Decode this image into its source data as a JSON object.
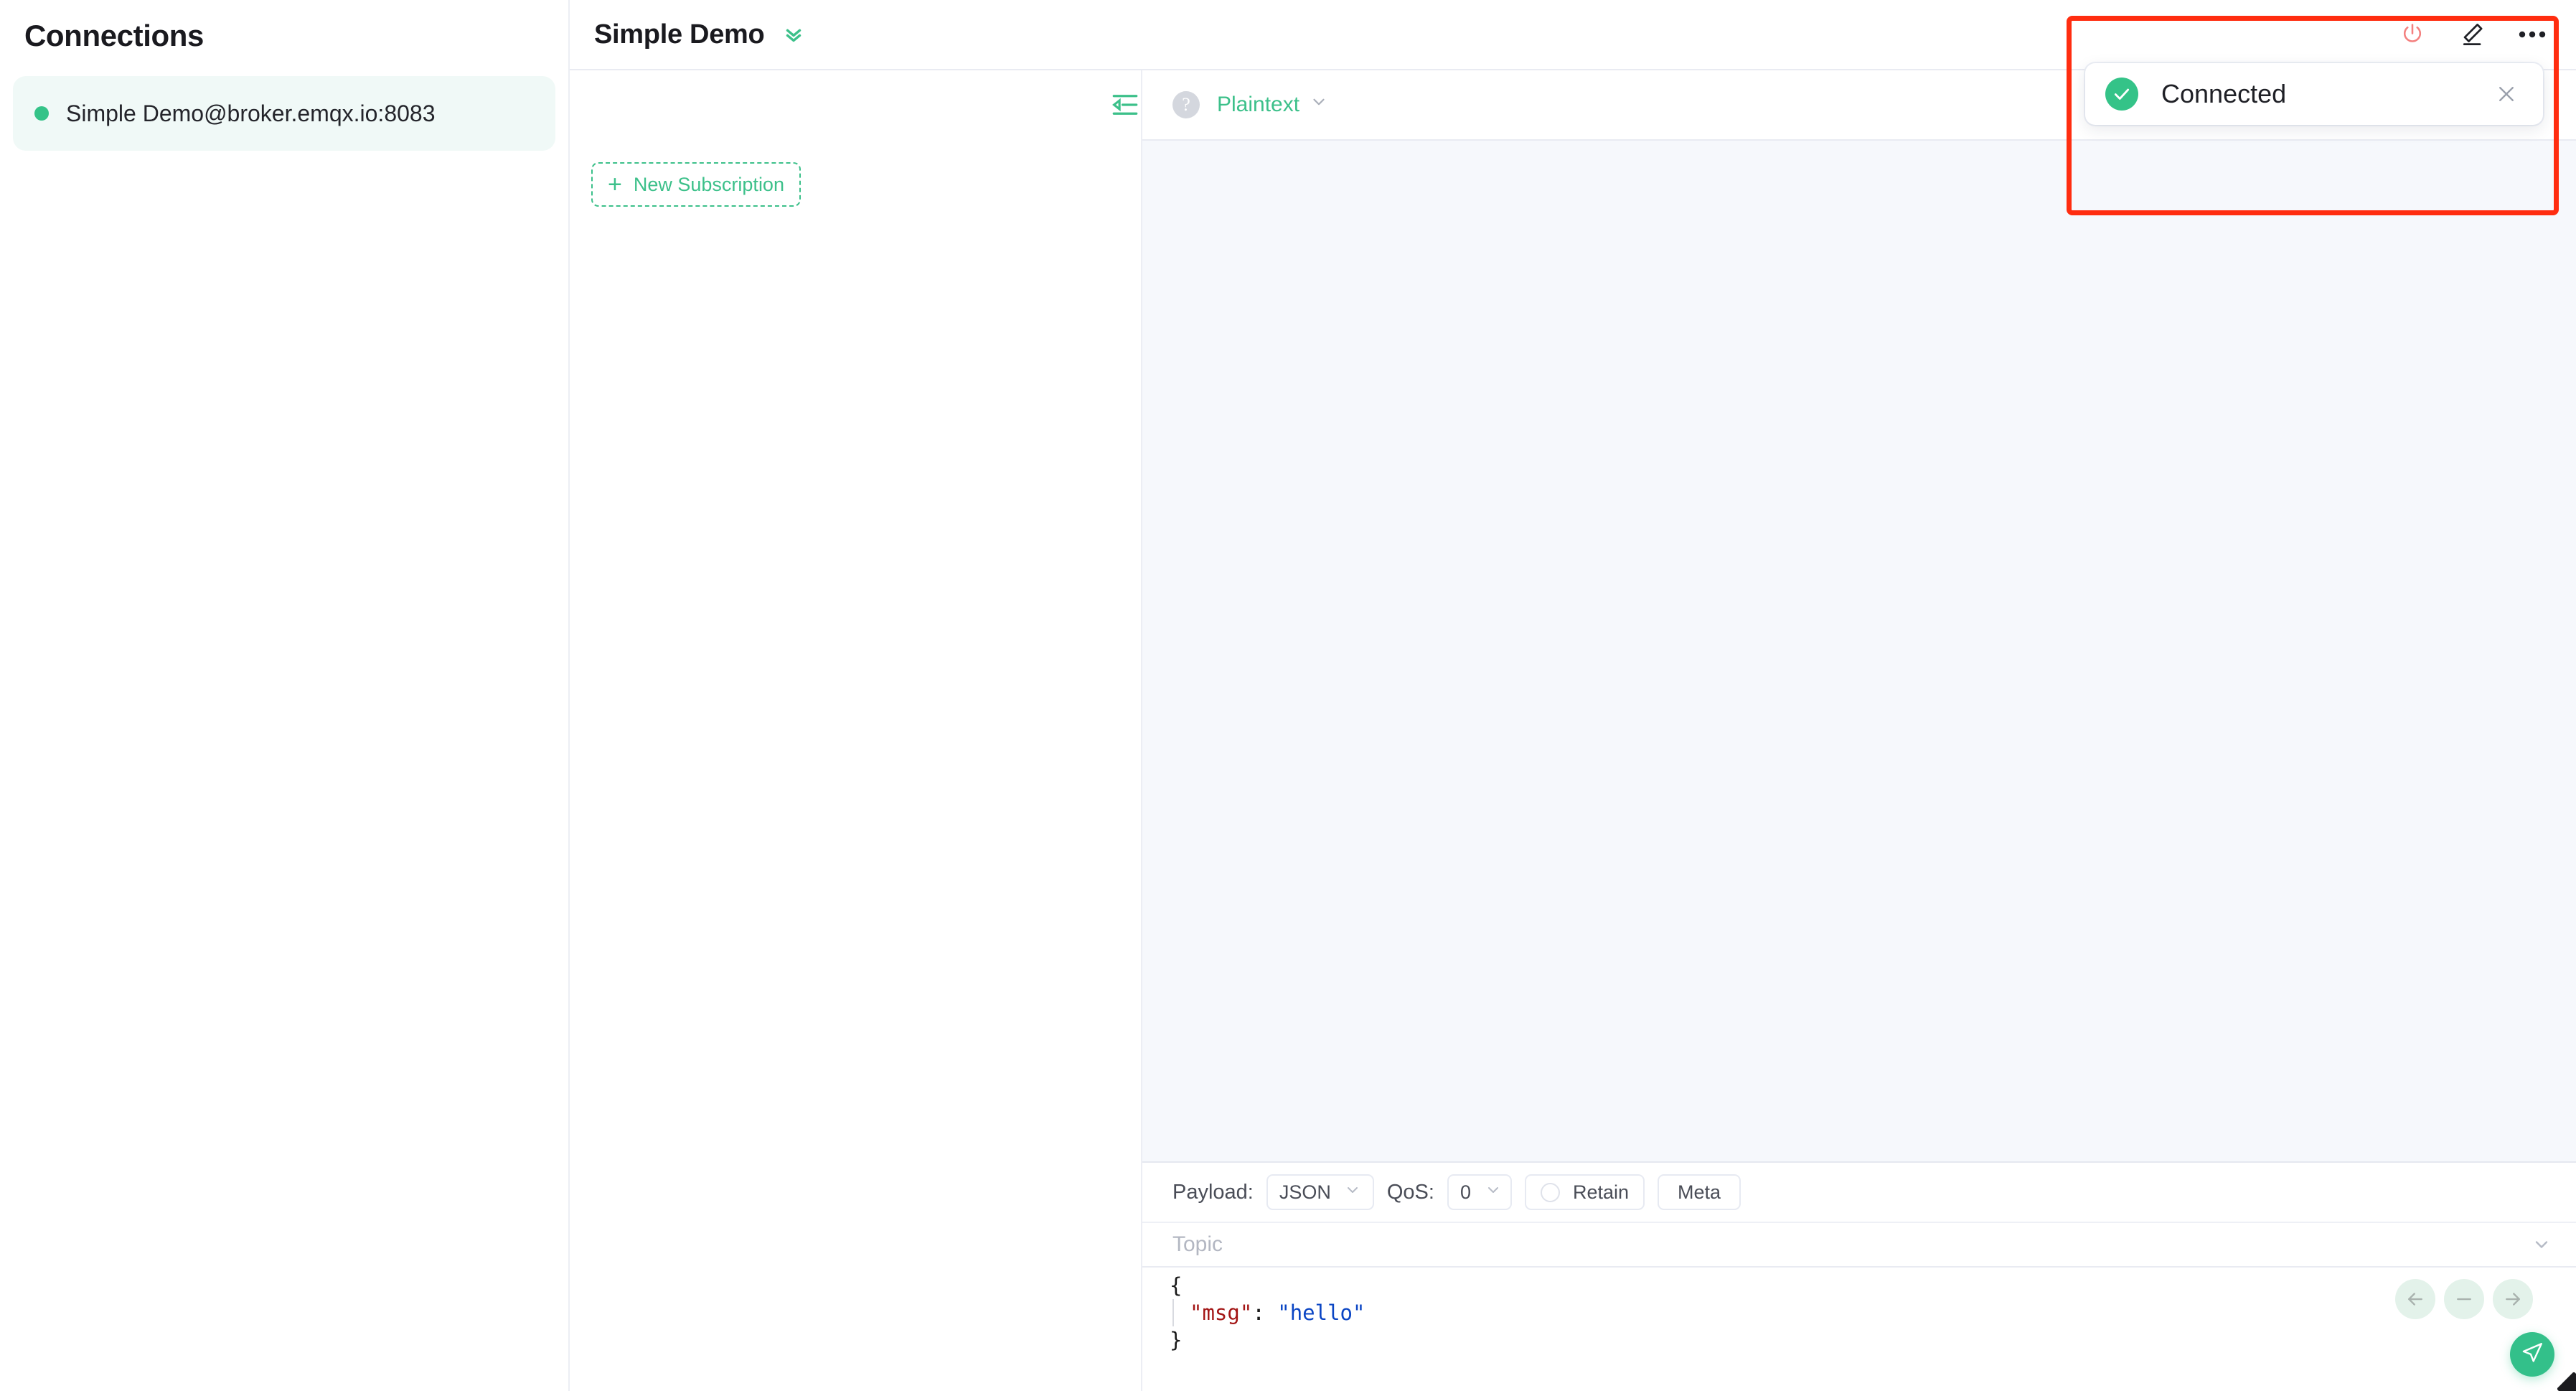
{
  "sidebar": {
    "title": "Connections",
    "connections": [
      {
        "label": "Simple Demo@broker.emqx.io:8083",
        "status_color": "#34c388",
        "status": "connected"
      }
    ]
  },
  "topbar": {
    "title": "Simple Demo",
    "collapse_icon": "chevron-double-down-icon",
    "actions": [
      {
        "name": "disconnect-button",
        "icon": "power-icon",
        "color": "#f47c7c"
      },
      {
        "name": "edit-button",
        "icon": "pencil-icon",
        "color": "#1f2026"
      },
      {
        "name": "more-button",
        "icon": "ellipsis-icon",
        "color": "#1f2026"
      }
    ]
  },
  "subscriptions": {
    "new_subscription_label": "New Subscription",
    "new_subscription_plus": "+",
    "items": []
  },
  "messages": {
    "collapse_icon": "collapse-left-icon",
    "help_icon": "?",
    "format_label": "Plaintext",
    "format_chevron": "chevron-down-icon",
    "items": []
  },
  "publish": {
    "payload_label": "Payload:",
    "payload_value": "JSON",
    "qos_label": "QoS:",
    "qos_value": "0",
    "retain_label": "Retain",
    "retain_checked": false,
    "meta_label": "Meta",
    "topic_placeholder": "Topic",
    "topic_value": "",
    "topic_chevron": "chevron-down-icon",
    "editor": {
      "line1": "{",
      "line2_key": "\"msg\"",
      "line2_colon": ": ",
      "line2_val": "\"hello\"",
      "line3": "}"
    },
    "nav_buttons": [
      {
        "name": "history-prev-button",
        "icon": "arrow-left-icon"
      },
      {
        "name": "history-clear-button",
        "icon": "minus-icon"
      },
      {
        "name": "history-next-button",
        "icon": "arrow-right-icon"
      }
    ],
    "send_icon": "send-icon"
  },
  "toast": {
    "message": "Connected",
    "icon": "check-circle-icon",
    "icon_color": "#34c388",
    "close_icon": "close-icon"
  },
  "annotation": {
    "type": "highlight-rectangle",
    "color": "#ff2d10"
  },
  "colors": {
    "accent_green": "#34c388",
    "panel_bg": "#f6f8fc",
    "border": "#e9ebf2",
    "annotation_red": "#ff2d10"
  }
}
